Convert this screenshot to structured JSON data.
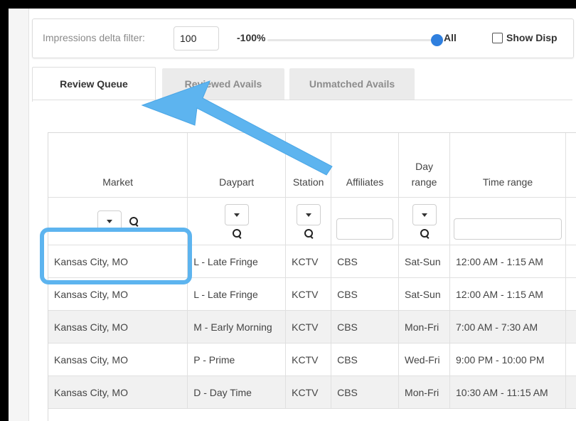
{
  "filter": {
    "label": "Impressions delta filter:",
    "value": "100",
    "min_label": "-100%",
    "max_label": "All",
    "slider_level_percent": 100,
    "checkbox_label": "Show Disp",
    "checkbox_checked": false
  },
  "tabs": [
    {
      "label": "Review Queue",
      "active": true
    },
    {
      "label": "Reviewed Avails",
      "active": false
    },
    {
      "label": "Unmatched Avails",
      "active": false
    }
  ],
  "table": {
    "columns": [
      "Market",
      "Daypart",
      "Station",
      "Affiliates",
      "Day range",
      "Time range"
    ],
    "day_range_header": [
      "Day",
      "range"
    ],
    "rows": [
      {
        "market": "Kansas City, MO",
        "daypart": "L - Late Fringe",
        "station": "KCTV",
        "affiliates": "CBS",
        "day_range": "Sat-Sun",
        "time_range": "12:00 AM - 1:15 AM"
      },
      {
        "market": "Kansas City, MO",
        "daypart": "L - Late Fringe",
        "station": "KCTV",
        "affiliates": "CBS",
        "day_range": "Sat-Sun",
        "time_range": "12:00 AM - 1:15 AM"
      },
      {
        "market": "Kansas City, MO",
        "daypart": "M - Early Morning",
        "station": "KCTV",
        "affiliates": "CBS",
        "day_range": "Mon-Fri",
        "time_range": "7:00 AM - 7:30 AM"
      },
      {
        "market": "Kansas City, MO",
        "daypart": "P - Prime",
        "station": "KCTV",
        "affiliates": "CBS",
        "day_range": "Wed-Fri",
        "time_range": "9:00 PM - 10:00 PM"
      },
      {
        "market": "Kansas City, MO",
        "daypart": "D - Day Time",
        "station": "KCTV",
        "affiliates": "CBS",
        "day_range": "Mon-Fri",
        "time_range": "10:30 AM - 11:15 AM"
      }
    ]
  },
  "colors": {
    "annotation": "#5db4ef",
    "slider_thumb": "#2f7fde",
    "border": "#000000"
  }
}
